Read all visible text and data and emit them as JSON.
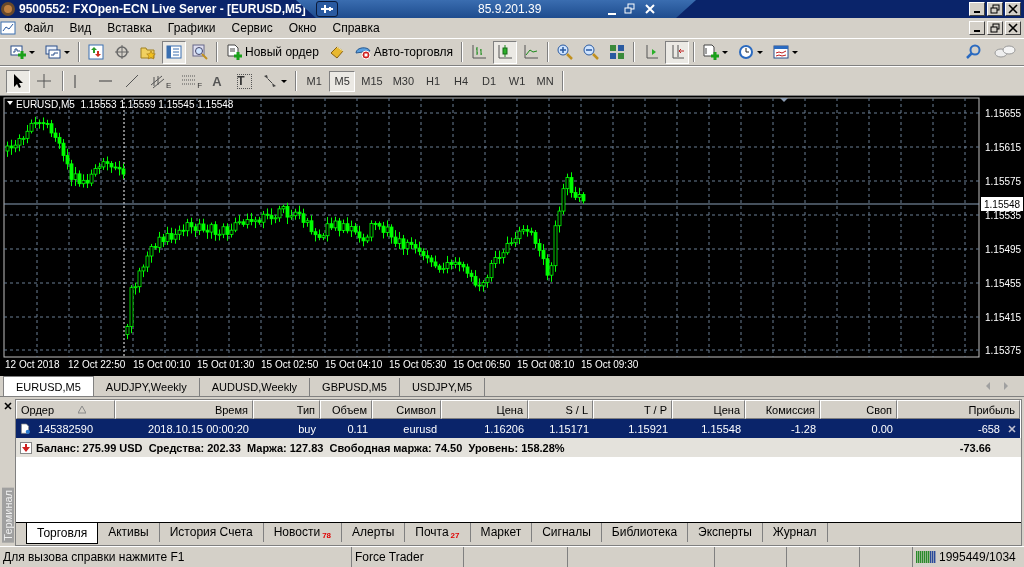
{
  "title_bar": {
    "title": "9500552: FXOpen-ECN Live Server - [EURUSD,M5]"
  },
  "remote_bar": {
    "address": "85.9.201.39"
  },
  "menu": [
    "Файл",
    "Вид",
    "Вставка",
    "Графики",
    "Сервис",
    "Окно",
    "Справка"
  ],
  "toolbar": {
    "groups": [
      {
        "buttons": [
          {
            "kind": "dropdown",
            "pressed": false
          },
          {
            "kind": "dropdown",
            "pressed": false
          }
        ]
      },
      {
        "buttons": [
          {
            "kind": "icon",
            "pressed": false
          },
          {
            "kind": "icon",
            "pressed": false
          },
          {
            "kind": "icon",
            "pressed": false
          },
          {
            "kind": "icon",
            "pressed": true
          },
          {
            "kind": "icon",
            "pressed": false
          }
        ]
      },
      {
        "buttons": [
          {
            "kind": "icon",
            "pressed": false,
            "label": "Новый ордер"
          },
          {
            "kind": "icon",
            "pressed": false
          },
          {
            "kind": "icon",
            "pressed": false,
            "label": "Авто-торговля"
          }
        ]
      },
      {
        "buttons": [
          {
            "kind": "icon",
            "pressed": false
          },
          {
            "kind": "icon",
            "pressed": true
          },
          {
            "kind": "icon",
            "pressed": false
          }
        ]
      },
      {
        "buttons": [
          {
            "kind": "icon",
            "pressed": false
          },
          {
            "kind": "icon",
            "pressed": false
          },
          {
            "kind": "icon",
            "pressed": false
          }
        ]
      },
      {
        "buttons": [
          {
            "kind": "icon",
            "pressed": false
          },
          {
            "kind": "icon",
            "pressed": true
          }
        ]
      },
      {
        "buttons": [
          {
            "kind": "dropdown",
            "pressed": false
          },
          {
            "kind": "dropdown",
            "pressed": false
          },
          {
            "kind": "dropdown",
            "pressed": false
          }
        ]
      }
    ]
  },
  "drawing_toolbar": {
    "buttons": [
      {
        "kind": "icon",
        "pressed": true
      },
      {
        "kind": "icon",
        "pressed": false
      },
      {
        "kind": "icon",
        "pressed": false
      },
      {
        "kind": "icon",
        "pressed": false
      },
      {
        "kind": "icon",
        "pressed": false
      },
      {
        "kind": "icon",
        "pressed": false,
        "label": "E"
      },
      {
        "kind": "icon",
        "pressed": false,
        "label": "F"
      },
      {
        "kind": "text",
        "pressed": false,
        "label": "A"
      },
      {
        "kind": "boxed",
        "pressed": false,
        "label": "T"
      },
      {
        "kind": "dropdown",
        "pressed": false
      }
    ]
  },
  "timeframes": [
    {
      "label": "M1",
      "selected": false
    },
    {
      "label": "M5",
      "selected": true
    },
    {
      "label": "M15",
      "selected": false
    },
    {
      "label": "M30",
      "selected": false
    },
    {
      "label": "H1",
      "selected": false
    },
    {
      "label": "H4",
      "selected": false
    },
    {
      "label": "D1",
      "selected": false
    },
    {
      "label": "W1",
      "selected": false
    },
    {
      "label": "MN",
      "selected": false
    }
  ],
  "chart": {
    "legend": "EURUSD,M5  1.15553 1.15559 1.15545 1.15548",
    "price_labels": [
      "1.15655",
      "1.15615",
      "1.15575",
      "1.15535",
      "1.15495",
      "1.15455",
      "1.15415",
      "1.15375"
    ],
    "current_price": "1.15548",
    "time_labels": [
      "12 Oct 2018",
      "12 Oct 22:50",
      "15 Oct 00:10",
      "15 Oct 01:30",
      "15 Oct 02:50",
      "15 Oct 04:10",
      "15 Oct 05:30",
      "15 Oct 06:50",
      "15 Oct 08:10",
      "15 Oct 09:30"
    ]
  },
  "chart_tabs": [
    {
      "label": "EURUSD,M5",
      "selected": true
    },
    {
      "label": "AUDJPY,Weekly",
      "selected": false
    },
    {
      "label": "AUDUSD,Weekly",
      "selected": false
    },
    {
      "label": "GBPUSD,M5",
      "selected": false
    },
    {
      "label": "USDJPY,M5",
      "selected": false
    }
  ],
  "terminal": {
    "title": "Терминал",
    "columns": [
      {
        "label": "Ордер",
        "sorted": true
      },
      {
        "label": "Время",
        "sorted": false
      },
      {
        "label": "Тип",
        "sorted": false
      },
      {
        "label": "Объем",
        "sorted": false
      },
      {
        "label": "Символ",
        "sorted": false
      },
      {
        "label": "Цена",
        "sorted": false
      },
      {
        "label": "S / L",
        "sorted": false
      },
      {
        "label": "T / P",
        "sorted": false
      },
      {
        "label": "Цена",
        "sorted": false
      },
      {
        "label": "Комиссия",
        "sorted": false
      },
      {
        "label": "Своп",
        "sorted": false
      },
      {
        "label": "Прибыль",
        "sorted": false
      }
    ],
    "orders": [
      {
        "selected": true,
        "cells": [
          "145382590",
          "2018.10.15 00:00:20",
          "buy",
          "0.11",
          "eurusd",
          "1.16206",
          "1.15171",
          "1.15921",
          "1.15548",
          "-1.28",
          "0.00",
          "-658"
        ]
      }
    ],
    "summary": {
      "text": "Баланс: 275.99 USD  Средства: 202.33  Маржа: 127.83  Свободная маржа: 74.50  Уровень: 158.28%",
      "profit": "-73.66"
    },
    "tabs": [
      {
        "label": "Торговля",
        "selected": true
      },
      {
        "label": "Активы",
        "selected": false
      },
      {
        "label": "История Счета",
        "selected": false
      },
      {
        "label": "Новости",
        "selected": false,
        "badge": "78"
      },
      {
        "label": "Алерты",
        "selected": false
      },
      {
        "label": "Почта",
        "selected": false,
        "badge": "27"
      },
      {
        "label": "Маркет",
        "selected": false
      },
      {
        "label": "Сигналы",
        "selected": false
      },
      {
        "label": "Библиотека",
        "selected": false
      },
      {
        "label": "Эксперты",
        "selected": false
      },
      {
        "label": "Журнал",
        "selected": false
      }
    ]
  },
  "status_bar": {
    "help": "Для вызова справки нажмите F1",
    "profile": "Force Trader",
    "traffic": "1995449/1034"
  }
}
